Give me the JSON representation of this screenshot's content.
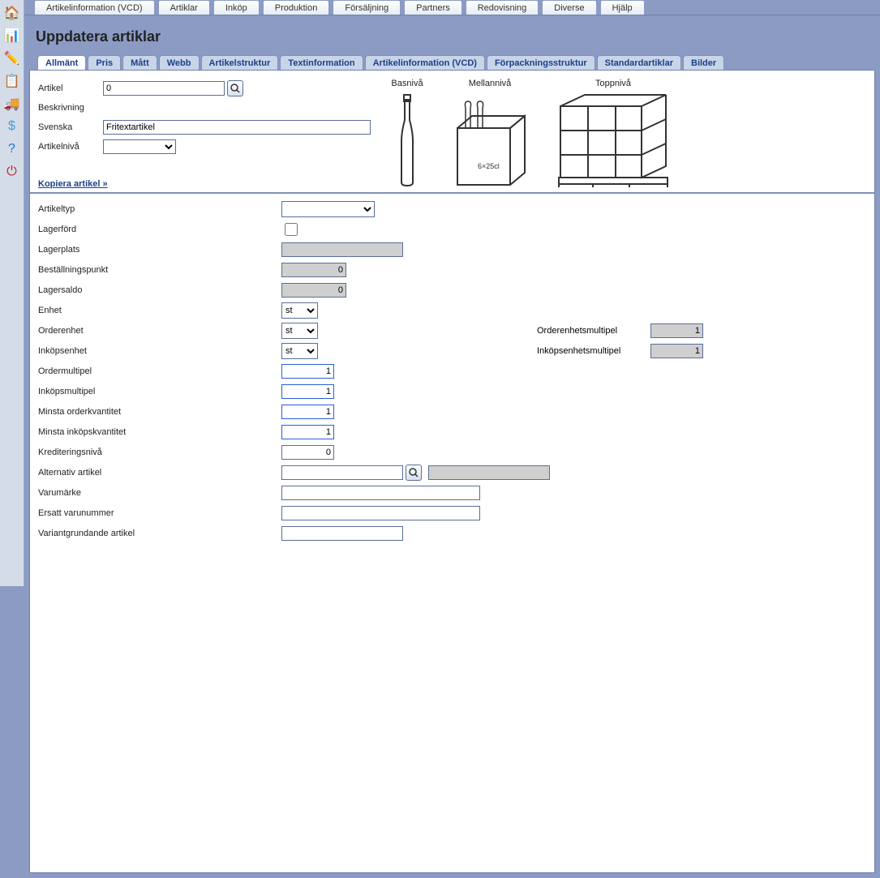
{
  "menubar": [
    "Artikelinformation (VCD)",
    "Artiklar",
    "Inköp",
    "Produktion",
    "Försäljning",
    "Partners",
    "Redovisning",
    "Diverse",
    "Hjälp"
  ],
  "page_title": "Uppdatera artiklar",
  "formtabs": [
    "Allmänt",
    "Pris",
    "Mått",
    "Webb",
    "Artikelstruktur",
    "Textinformation",
    "Artikelinformation (VCD)",
    "Förpackningsstruktur",
    "Standardartiklar",
    "Bilder"
  ],
  "active_tab_index": 0,
  "header": {
    "artikel_label": "Artikel",
    "artikel_value": "0",
    "beskrivning_label": "Beskrivning",
    "svenska_label": "Svenska",
    "svenska_value": "Fritextartikel",
    "artikelniva_label": "Artikelnivå",
    "artikelniva_value": "",
    "copy_link": "Kopiera artikel »",
    "levels": {
      "bas": "Basnivå",
      "mellan": "Mellannivå",
      "topp": "Toppnivå"
    }
  },
  "form": {
    "artikeltyp_label": "Artikeltyp",
    "artikeltyp_value": "",
    "lagerford_label": "Lagerförd",
    "lagerford_checked": false,
    "lagerplats_label": "Lagerplats",
    "lagerplats_value": "",
    "bestallningspunkt_label": "Beställningspunkt",
    "bestallningspunkt_value": "0",
    "lagersaldo_label": "Lagersaldo",
    "lagersaldo_value": "0",
    "enhet_label": "Enhet",
    "enhet_value": "st",
    "orderenhet_label": "Orderenhet",
    "orderenhet_value": "st",
    "orderenhetsmultipel_label": "Orderenhetsmultipel",
    "orderenhetsmultipel_value": "1",
    "inkopsenhet_label": "Inköpsenhet",
    "inkopsenhet_value": "st",
    "inkopsenhetsmultipel_label": "Inköpsenhetsmultipel",
    "inkopsenhetsmultipel_value": "1",
    "ordermultipel_label": "Ordermultipel",
    "ordermultipel_value": "1",
    "inkopsmultipel_label": "Inköpsmultipel",
    "inkopsmultipel_value": "1",
    "minsta_order_label": "Minsta orderkvantitet",
    "minsta_order_value": "1",
    "minsta_inkop_label": "Minsta inköpskvantitet",
    "minsta_inkop_value": "1",
    "krediteringsniva_label": "Krediteringsnivå",
    "krediteringsniva_value": "0",
    "alt_artikel_label": "Alternativ artikel",
    "alt_artikel_value": "",
    "varumarke_label": "Varumärke",
    "varumarke_value": "",
    "ersatt_varunummer_label": "Ersatt varunummer",
    "ersatt_varunummer_value": "",
    "variant_label": "Variantgrundande artikel",
    "variant_value": ""
  }
}
